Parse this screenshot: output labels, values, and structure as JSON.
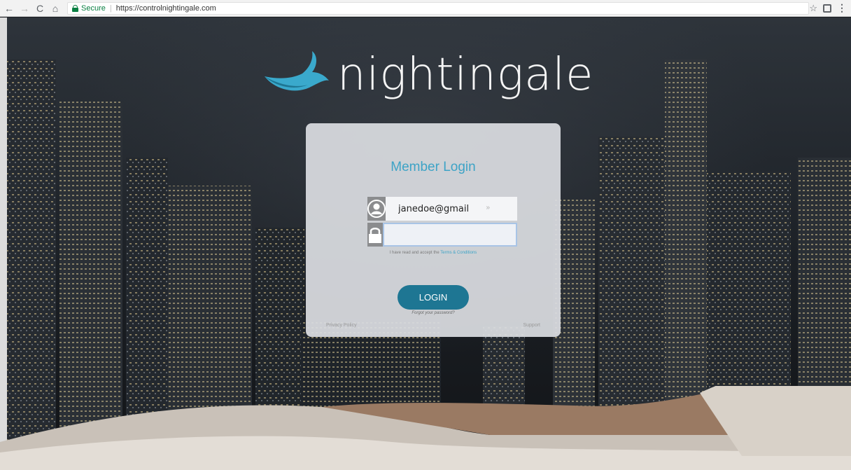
{
  "browser": {
    "secure_label": "Secure",
    "separator": "|",
    "url": "https://controlnightingale.com",
    "back_icon": "arrow-left-icon",
    "forward_icon": "arrow-right-icon",
    "reload_icon": "reload-icon",
    "home_icon": "home-icon"
  },
  "logo": {
    "text": "nightingale",
    "accent_color": "#3aa9cc"
  },
  "login": {
    "title": "Member Login",
    "username_value": "janedoe@gmail",
    "password_value": "",
    "terms_prefix": "I have read and accept the ",
    "terms_link": "Terms & Conditions",
    "button_label": "LOGIN",
    "forgot_label": "Forgot your password?",
    "privacy_label": "Privacy Policy",
    "support_label": "Support"
  },
  "colors": {
    "title": "#3da3c6",
    "button": "#1e7693",
    "card": "#dadde1"
  }
}
